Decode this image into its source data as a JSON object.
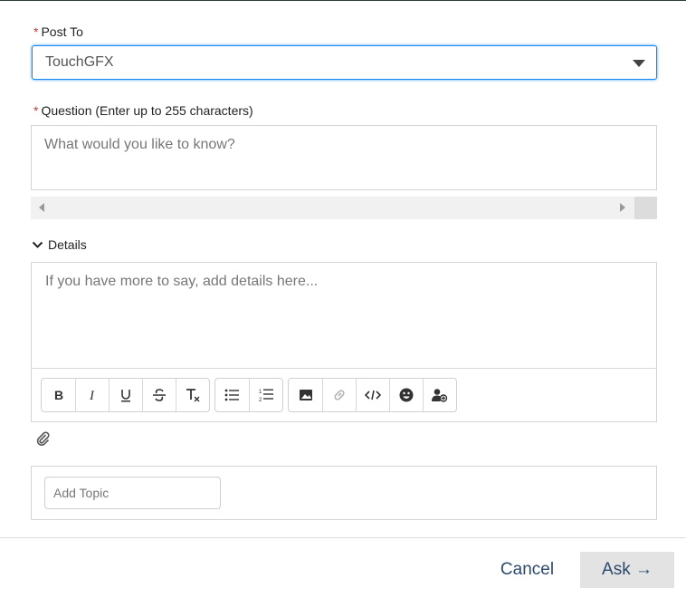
{
  "post_to": {
    "required_mark": "*",
    "label": "Post To",
    "selected": "TouchGFX"
  },
  "question": {
    "required_mark": "*",
    "label": "Question (Enter up to 255 characters)",
    "placeholder": "What would you like to know?"
  },
  "details": {
    "toggle_label": "Details",
    "expanded": true,
    "placeholder": "If you have more to say, add details here..."
  },
  "toolbar": {
    "groups": [
      [
        "bold-icon",
        "italic-icon",
        "underline-icon",
        "strikethrough-icon",
        "clear-format-icon"
      ],
      [
        "bulleted-list-icon",
        "numbered-list-icon"
      ],
      [
        "image-icon",
        "link-icon",
        "code-icon",
        "emoji-icon",
        "mention-icon"
      ]
    ]
  },
  "attach": {
    "icon": "paperclip-icon"
  },
  "topic": {
    "placeholder": "Add Topic"
  },
  "footer": {
    "cancel_label": "Cancel",
    "ask_label": "Ask →"
  },
  "colors": {
    "focus_border": "#1589ee",
    "required": "#c23934",
    "button_text": "#2a4a6e",
    "ask_bg": "#e3e3e3"
  }
}
